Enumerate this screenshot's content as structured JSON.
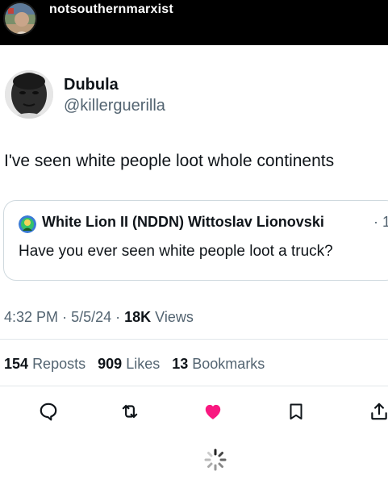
{
  "header": {
    "username": "notsouthernmarxist"
  },
  "tweet": {
    "author_name": "Dubula",
    "author_handle": "@killerguerilla",
    "text": "I've seen white people loot whole continents",
    "quoted": {
      "author": "White Lion II (NDDN) Wittoslav Lionovski",
      "separator": "· 1",
      "text": "Have you ever seen white people loot a truck?"
    },
    "meta": {
      "time": "4:32 PM",
      "date": "5/5/24",
      "views_count": "18K",
      "views_label": "Views"
    },
    "stats": [
      {
        "count": "154",
        "label": "Reposts"
      },
      {
        "count": "909",
        "label": "Likes"
      },
      {
        "count": "13",
        "label": "Bookmarks"
      }
    ]
  },
  "actions": [
    {
      "name": "reply",
      "icon": "reply-icon"
    },
    {
      "name": "retweet",
      "icon": "retweet-icon"
    },
    {
      "name": "like",
      "icon": "heart-icon",
      "active": true,
      "color": "#f91880"
    },
    {
      "name": "bookmark",
      "icon": "bookmark-icon"
    },
    {
      "name": "share",
      "icon": "share-icon"
    }
  ],
  "colors": {
    "text": "#0f1419",
    "secondary": "#536471",
    "like": "#f91880",
    "border": "#cfd9de",
    "header_bg": "#000000"
  }
}
